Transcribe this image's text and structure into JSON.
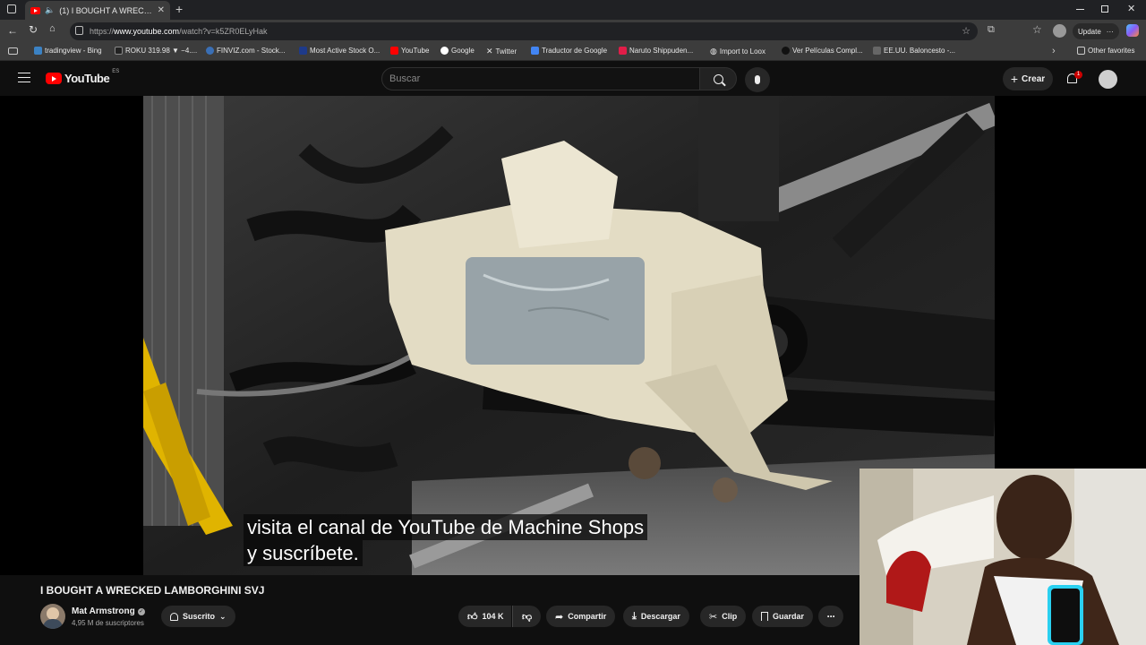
{
  "browser": {
    "tab_title": "(1) I BOUGHT A WRECKED L...",
    "url_prefix": "https://",
    "url_host": "www.youtube.com",
    "url_path": "/watch?v=k5ZR0ELyHak",
    "update_label": "Update",
    "other_favorites": "Other favorites"
  },
  "bookmarks": [
    {
      "label": "tradingview - Bing",
      "icon": "bing-icon"
    },
    {
      "label": "ROKU 319.98 ▼ −4....",
      "icon": "tradingview-icon"
    },
    {
      "label": "FINVIZ.com - Stock...",
      "icon": "finviz-icon"
    },
    {
      "label": "Most Active Stock O...",
      "icon": "stock-icon"
    },
    {
      "label": "YouTube",
      "icon": "youtube-icon"
    },
    {
      "label": "Google",
      "icon": "google-icon"
    },
    {
      "label": "Twitter",
      "icon": "x-icon"
    },
    {
      "label": "Traductor de Google",
      "icon": "translate-icon"
    },
    {
      "label": "Naruto Shippuden...",
      "icon": "site-icon"
    },
    {
      "label": "Import to Loox",
      "icon": "globe-icon"
    },
    {
      "label": "Ver Películas Compl...",
      "icon": "shield-icon"
    },
    {
      "label": "EE.UU. Baloncesto -...",
      "icon": "page-icon"
    }
  ],
  "youtube": {
    "logo_text": "YouTube",
    "region": "ES",
    "search_placeholder": "Buscar",
    "create_label": "Crear",
    "notification_count": "1"
  },
  "video": {
    "caption_line1": "visita el canal de YouTube de Machine Shops",
    "caption_line2": "y suscríbete.",
    "title": "I BOUGHT A WRECKED LAMBORGHINI SVJ",
    "channel_name": "Mat Armstrong",
    "subscribers": "4,95 M de suscriptores",
    "subscribed_label": "Suscrito",
    "likes": "104 K",
    "share_label": "Compartir",
    "download_label": "Descargar",
    "clip_label": "Clip",
    "save_label": "Guardar"
  },
  "colors": {
    "youtube_red": "#ff0000",
    "background": "#0f0f0f",
    "pill": "#272727"
  }
}
